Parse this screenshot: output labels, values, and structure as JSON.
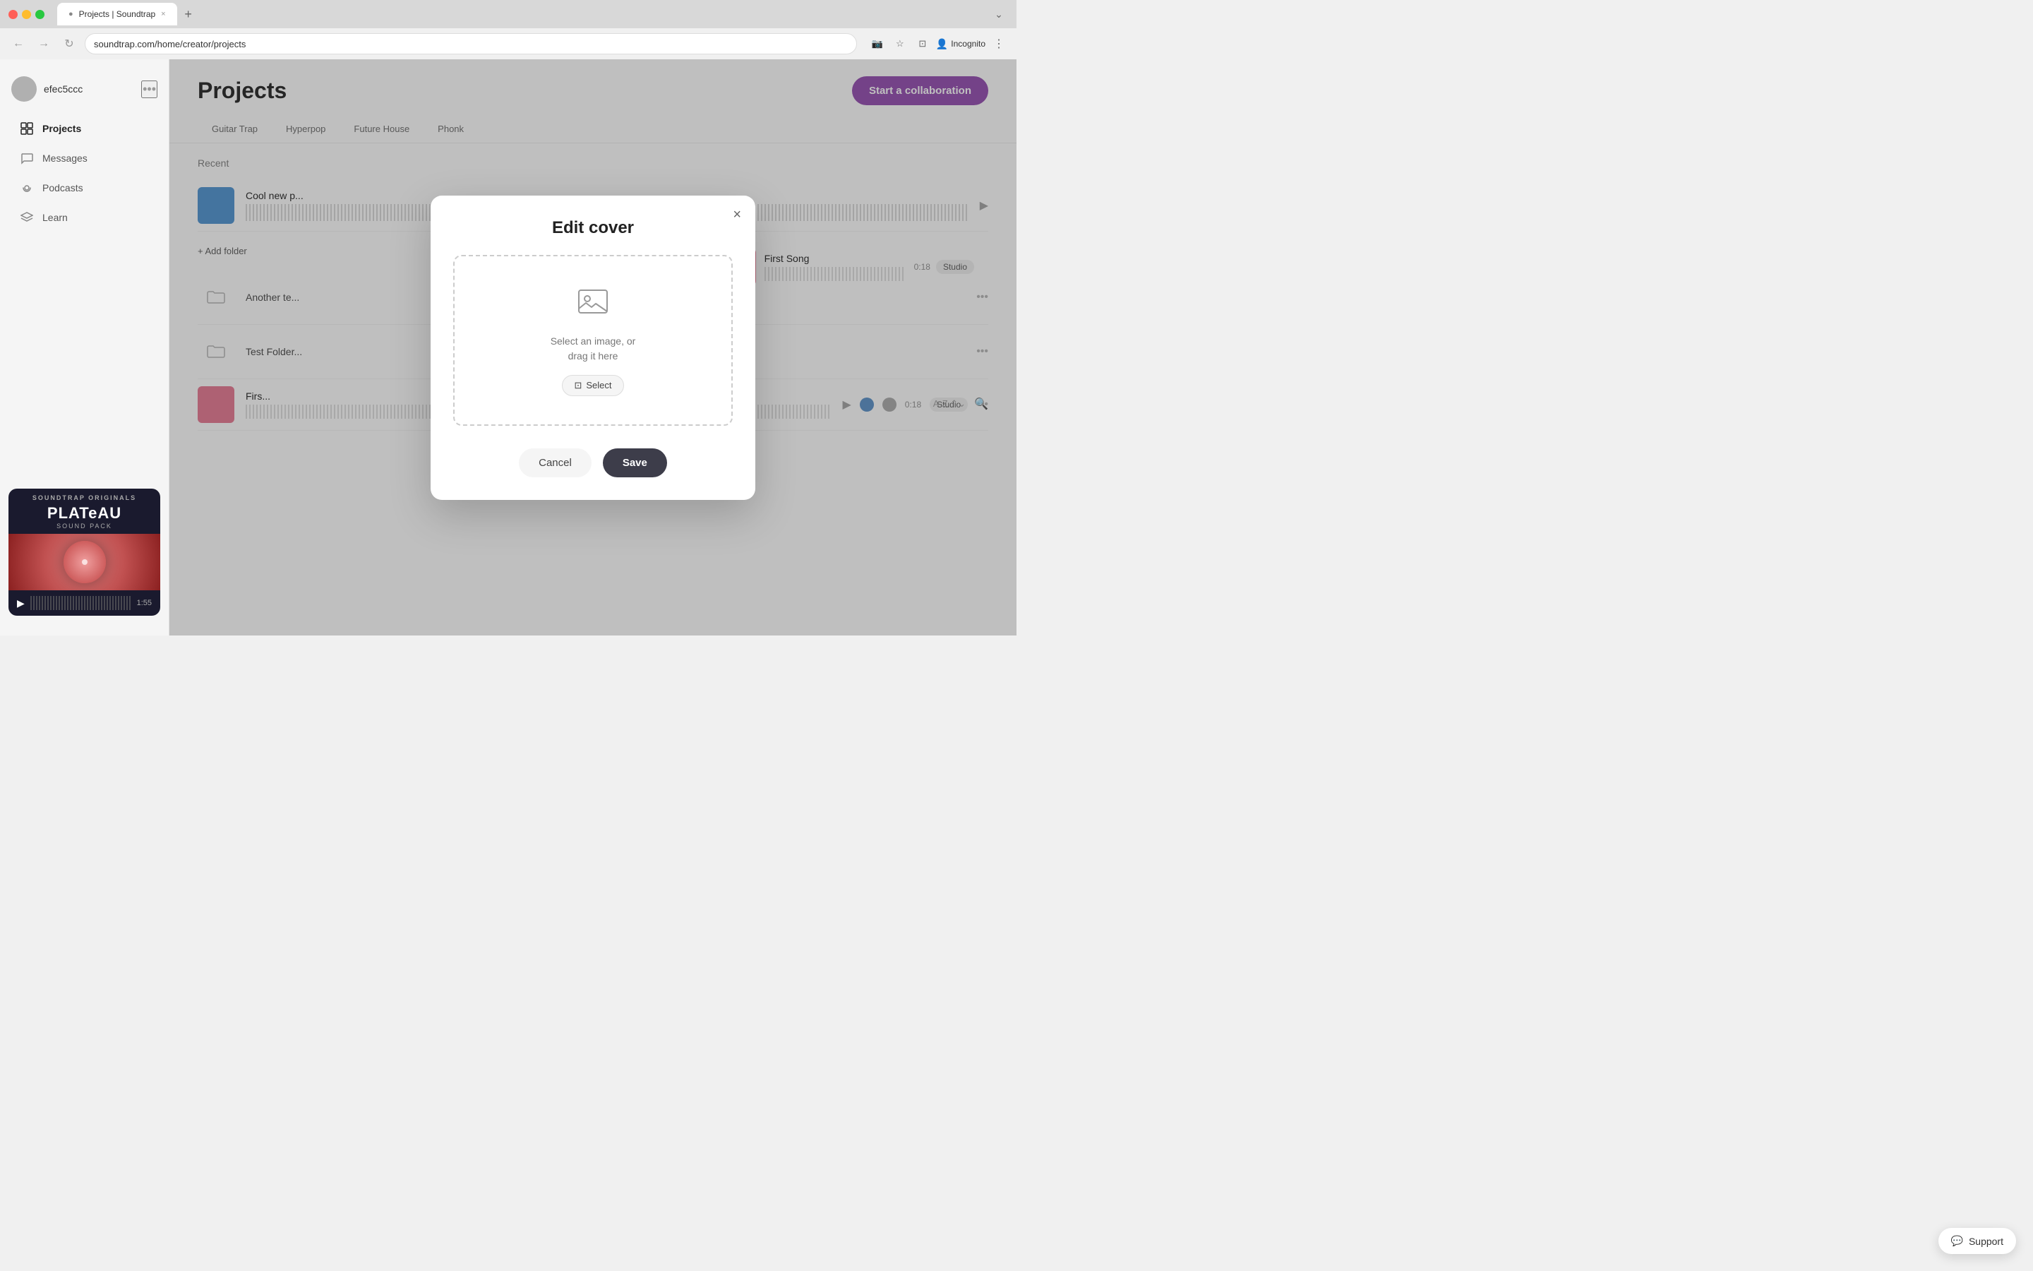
{
  "browser": {
    "tab_title": "Projects | Soundtrap",
    "address": "soundtrap.com/home/creator/projects",
    "back_btn": "←",
    "forward_btn": "→",
    "refresh_btn": "↻",
    "new_tab_btn": "+",
    "incognito_label": "Incognito",
    "collapse_btn": "⌄"
  },
  "sidebar": {
    "username": "efec5ccc",
    "more_icon": "•••",
    "nav_items": [
      {
        "id": "projects",
        "label": "Projects",
        "active": true
      },
      {
        "id": "messages",
        "label": "Messages",
        "active": false
      },
      {
        "id": "podcasts",
        "label": "Podcasts",
        "active": false
      },
      {
        "id": "learn",
        "label": "Learn",
        "active": false
      }
    ],
    "originals": {
      "section_label": "SOUNDTRAP ORIGINALS",
      "title": "PLATeAU",
      "subtitle": "SOUND PACK",
      "duration": "1:55"
    }
  },
  "main": {
    "page_title": "Projects",
    "collab_button": "Start a collaboration",
    "genre_tabs": [
      "Guitar Trap",
      "Hyperpop",
      "Future House",
      "Phonk"
    ],
    "recent_label": "Recent",
    "add_folder_label": "+ Add folder",
    "sort_label": "A-Z",
    "projects": [
      {
        "id": "cool-new",
        "name": "Cool new p...",
        "thumb_color": "#5b9bd5",
        "duration": null,
        "badge": null,
        "truncated": true
      },
      {
        "id": "first-song-right",
        "name": "First Song",
        "thumb_color": "#e8829a",
        "duration": "0:18",
        "badge": "Studio"
      }
    ],
    "folders": [
      {
        "id": "another-te",
        "name": "Another te..."
      },
      {
        "id": "test-folder",
        "name": "Test Folder..."
      }
    ],
    "bottom_project": {
      "name": "Firs...",
      "thumb_color": "#e8829a",
      "duration": "0:18",
      "badge": "Studio"
    }
  },
  "modal": {
    "title": "Edit cover",
    "close_icon": "×",
    "upload_icon": "🖼",
    "upload_text_line1": "Select an image, or",
    "upload_text_line2": "drag it here",
    "select_label": "Select",
    "select_icon": "⊡",
    "cancel_label": "Cancel",
    "save_label": "Save"
  },
  "support": {
    "label": "Support",
    "icon": "💬"
  }
}
